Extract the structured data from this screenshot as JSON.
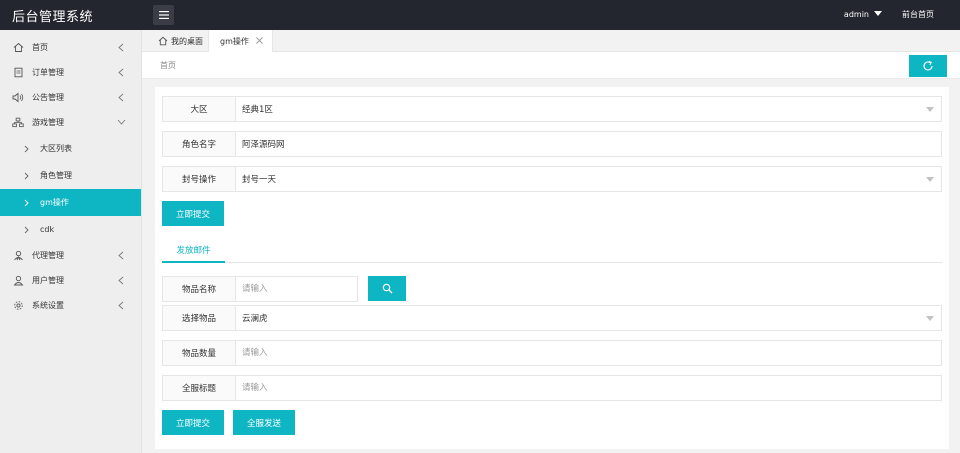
{
  "header": {
    "logo": "后台管理系统",
    "user": "admin",
    "frontend_link": "前台首页"
  },
  "sidebar": {
    "items": [
      {
        "label": "首页",
        "icon": "home-icon"
      },
      {
        "label": "订单管理",
        "icon": "order-icon"
      },
      {
        "label": "公告管理",
        "icon": "speaker-icon"
      },
      {
        "label": "游戏管理",
        "icon": "sitemap-icon"
      }
    ],
    "game_sub": [
      {
        "label": "大区列表"
      },
      {
        "label": "角色管理"
      },
      {
        "label": "gm操作"
      },
      {
        "label": "cdk"
      }
    ],
    "more_items": [
      {
        "label": "代理管理",
        "icon": "agent-icon"
      },
      {
        "label": "用户管理",
        "icon": "user-icon"
      },
      {
        "label": "系统设置",
        "icon": "gear-icon"
      }
    ]
  },
  "tabs": {
    "home": "我的桌面",
    "active": "gm操作"
  },
  "breadcrumb": "首页",
  "form1": {
    "region_label": "大区",
    "region_value": "经典1区",
    "role_label": "角色名字",
    "role_value": "阿泽源码网",
    "ban_label": "封号操作",
    "ban_value": "封号一天",
    "submit": "立即提交"
  },
  "mail_tab": "发放邮件",
  "form2": {
    "item_name_label": "物品名称",
    "item_name_placeholder": "请输入",
    "select_item_label": "选择物品",
    "select_item_value": "云澜虎",
    "qty_label": "物品数量",
    "qty_placeholder": "请输入",
    "title_label": "全服标题",
    "title_placeholder": "请输入",
    "submit": "立即提交",
    "broadcast": "全服发送"
  },
  "colors": {
    "accent": "#0eb5c3",
    "header_bg": "#23262e",
    "sidebar_bg": "#eeeeee"
  }
}
